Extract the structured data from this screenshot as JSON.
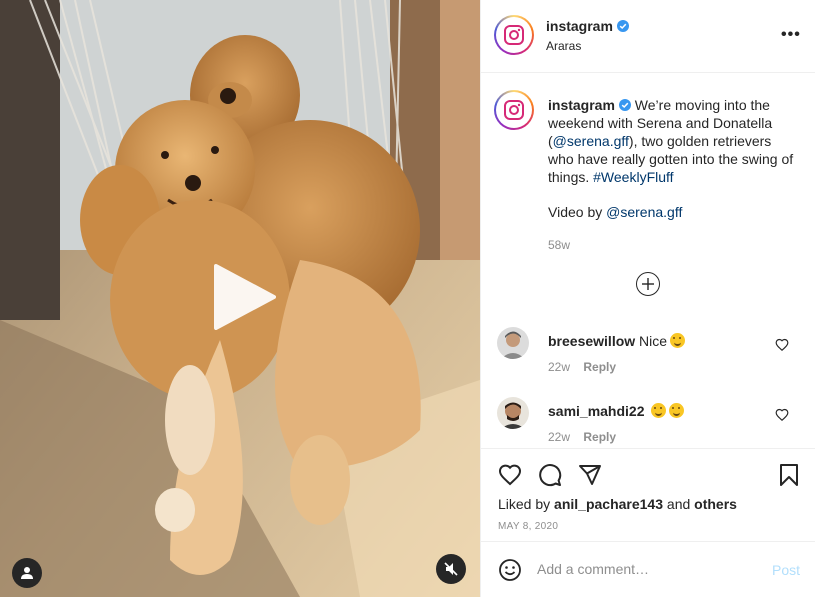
{
  "header": {
    "username": "instagram",
    "location": "Araras",
    "more_label": "•••"
  },
  "caption": {
    "username": "instagram",
    "text_1": " We’re moving into the weekend with Serena and Donatella (",
    "mention_1": "@serena.gff",
    "text_2": "), two golden retrievers who have really gotten into the swing of things. ",
    "hashtag": "#WeeklyFluff",
    "video_prefix": "Video by ",
    "video_mention": "@serena.gff",
    "time": "58w"
  },
  "comments": [
    {
      "username": "breesewillow",
      "text": "Nice",
      "time": "22w",
      "reply_label": "Reply"
    },
    {
      "username": "sami_mahdi22",
      "text": "",
      "time": "22w",
      "reply_label": "Reply"
    }
  ],
  "actions": {
    "liked_prefix": "Liked by ",
    "liked_user": "anil_pachare143",
    "liked_mid": " and ",
    "liked_suffix": "others",
    "date": "MAY 8, 2020"
  },
  "comment_box": {
    "placeholder": "Add a comment…",
    "post_label": "Post"
  },
  "colors": {
    "verified": "#3897f0",
    "link": "#00376b",
    "muted": "#8e8e8e",
    "post_disabled": "#b2dffc"
  },
  "icons": [
    "play-icon",
    "user-tag-icon",
    "mute-icon",
    "verified-icon",
    "more-icon",
    "add-circle-icon",
    "heart-icon",
    "comment-icon",
    "share-icon",
    "bookmark-icon",
    "smile-icon"
  ]
}
